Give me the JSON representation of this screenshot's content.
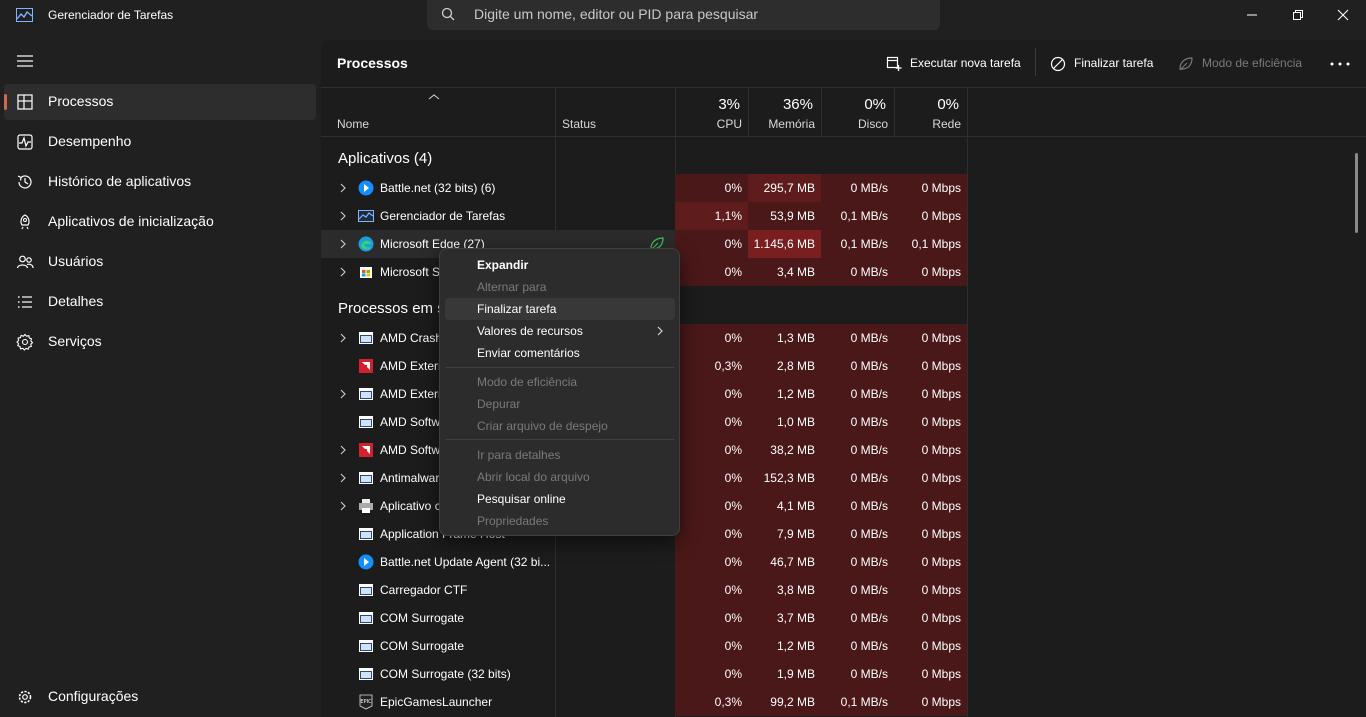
{
  "app": {
    "title": "Gerenciador de Tarefas"
  },
  "search": {
    "placeholder": "Digite um nome, editor ou PID para pesquisar"
  },
  "sidebar": {
    "items": [
      {
        "label": "Processos",
        "icon": "processes-icon"
      },
      {
        "label": "Desempenho",
        "icon": "performance-icon"
      },
      {
        "label": "Histórico de aplicativos",
        "icon": "history-icon"
      },
      {
        "label": "Aplicativos de inicialização",
        "icon": "startup-icon"
      },
      {
        "label": "Usuários",
        "icon": "users-icon"
      },
      {
        "label": "Detalhes",
        "icon": "details-icon"
      },
      {
        "label": "Serviços",
        "icon": "services-icon"
      }
    ],
    "settings_label": "Configurações"
  },
  "main": {
    "title": "Processos",
    "toolbar": {
      "run_new_task": "Executar nova tarefa",
      "end_task": "Finalizar tarefa",
      "efficiency_mode": "Modo de eficiência"
    },
    "columns": {
      "name": "Nome",
      "status": "Status",
      "cpu": {
        "label": "CPU",
        "pct": "3%"
      },
      "memory": {
        "label": "Memória",
        "pct": "36%"
      },
      "disk": {
        "label": "Disco",
        "pct": "0%"
      },
      "network": {
        "label": "Rede",
        "pct": "0%"
      }
    },
    "groups": {
      "apps": "Aplicativos (4)",
      "background": "Processos em s"
    },
    "rows": [
      {
        "name": "Battle.net (32 bits) (6)",
        "cpu": "0%",
        "mem": "295,7 MB",
        "disk": "0 MB/s",
        "net": "0 Mbps"
      },
      {
        "name": "Gerenciador de Tarefas",
        "cpu": "1,1%",
        "mem": "53,9 MB",
        "disk": "0,1 MB/s",
        "net": "0 Mbps"
      },
      {
        "name": "Microsoft Edge (27)",
        "cpu": "0%",
        "mem": "1.145,6 MB",
        "disk": "0,1 MB/s",
        "net": "0,1 Mbps"
      },
      {
        "name": "Microsoft S",
        "cpu": "0%",
        "mem": "3,4 MB",
        "disk": "0 MB/s",
        "net": "0 Mbps"
      },
      {
        "name": "AMD Crash",
        "cpu": "0%",
        "mem": "1,3 MB",
        "disk": "0 MB/s",
        "net": "0 Mbps"
      },
      {
        "name": "AMD Extern",
        "cpu": "0,3%",
        "mem": "2,8 MB",
        "disk": "0 MB/s",
        "net": "0 Mbps"
      },
      {
        "name": "AMD Extern",
        "cpu": "0%",
        "mem": "1,2 MB",
        "disk": "0 MB/s",
        "net": "0 Mbps"
      },
      {
        "name": "AMD Softw",
        "cpu": "0%",
        "mem": "1,0 MB",
        "disk": "0 MB/s",
        "net": "0 Mbps"
      },
      {
        "name": "AMD Softw",
        "cpu": "0%",
        "mem": "38,2 MB",
        "disk": "0 MB/s",
        "net": "0 Mbps"
      },
      {
        "name": "Antimalwar",
        "cpu": "0%",
        "mem": "152,3 MB",
        "disk": "0 MB/s",
        "net": "0 Mbps"
      },
      {
        "name": "Aplicativo c",
        "cpu": "0%",
        "mem": "4,1 MB",
        "disk": "0 MB/s",
        "net": "0 Mbps"
      },
      {
        "name": "Application Frame Host",
        "cpu": "0%",
        "mem": "7,9 MB",
        "disk": "0 MB/s",
        "net": "0 Mbps"
      },
      {
        "name": "Battle.net Update Agent (32 bi...",
        "cpu": "0%",
        "mem": "46,7 MB",
        "disk": "0 MB/s",
        "net": "0 Mbps"
      },
      {
        "name": "Carregador CTF",
        "cpu": "0%",
        "mem": "3,8 MB",
        "disk": "0 MB/s",
        "net": "0 Mbps"
      },
      {
        "name": "COM Surrogate",
        "cpu": "0%",
        "mem": "3,7 MB",
        "disk": "0 MB/s",
        "net": "0 Mbps"
      },
      {
        "name": "COM Surrogate",
        "cpu": "0%",
        "mem": "1,2 MB",
        "disk": "0 MB/s",
        "net": "0 Mbps"
      },
      {
        "name": "COM Surrogate (32 bits)",
        "cpu": "0%",
        "mem": "1,9 MB",
        "disk": "0 MB/s",
        "net": "0 Mbps"
      },
      {
        "name": "EpicGamesLauncher",
        "cpu": "0,3%",
        "mem": "99,2 MB",
        "disk": "0,1 MB/s",
        "net": "0 Mbps"
      }
    ]
  },
  "context_menu": {
    "items": [
      {
        "label": "Expandir"
      },
      {
        "label": "Alternar para"
      },
      {
        "label": "Finalizar tarefa"
      },
      {
        "label": "Valores de recursos"
      },
      {
        "label": "Enviar comentários"
      },
      {
        "label": "Modo de eficiência"
      },
      {
        "label": "Depurar"
      },
      {
        "label": "Criar arquivo de despejo"
      },
      {
        "label": "Ir para detalhes"
      },
      {
        "label": "Abrir local do arquivo"
      },
      {
        "label": "Pesquisar online"
      },
      {
        "label": "Propriedades"
      }
    ]
  },
  "colors": {
    "heat_low": "#4a1818",
    "heat_mid": "#5e1c1c",
    "heat_high": "#7a1f1f",
    "accent": "#d0694f"
  }
}
